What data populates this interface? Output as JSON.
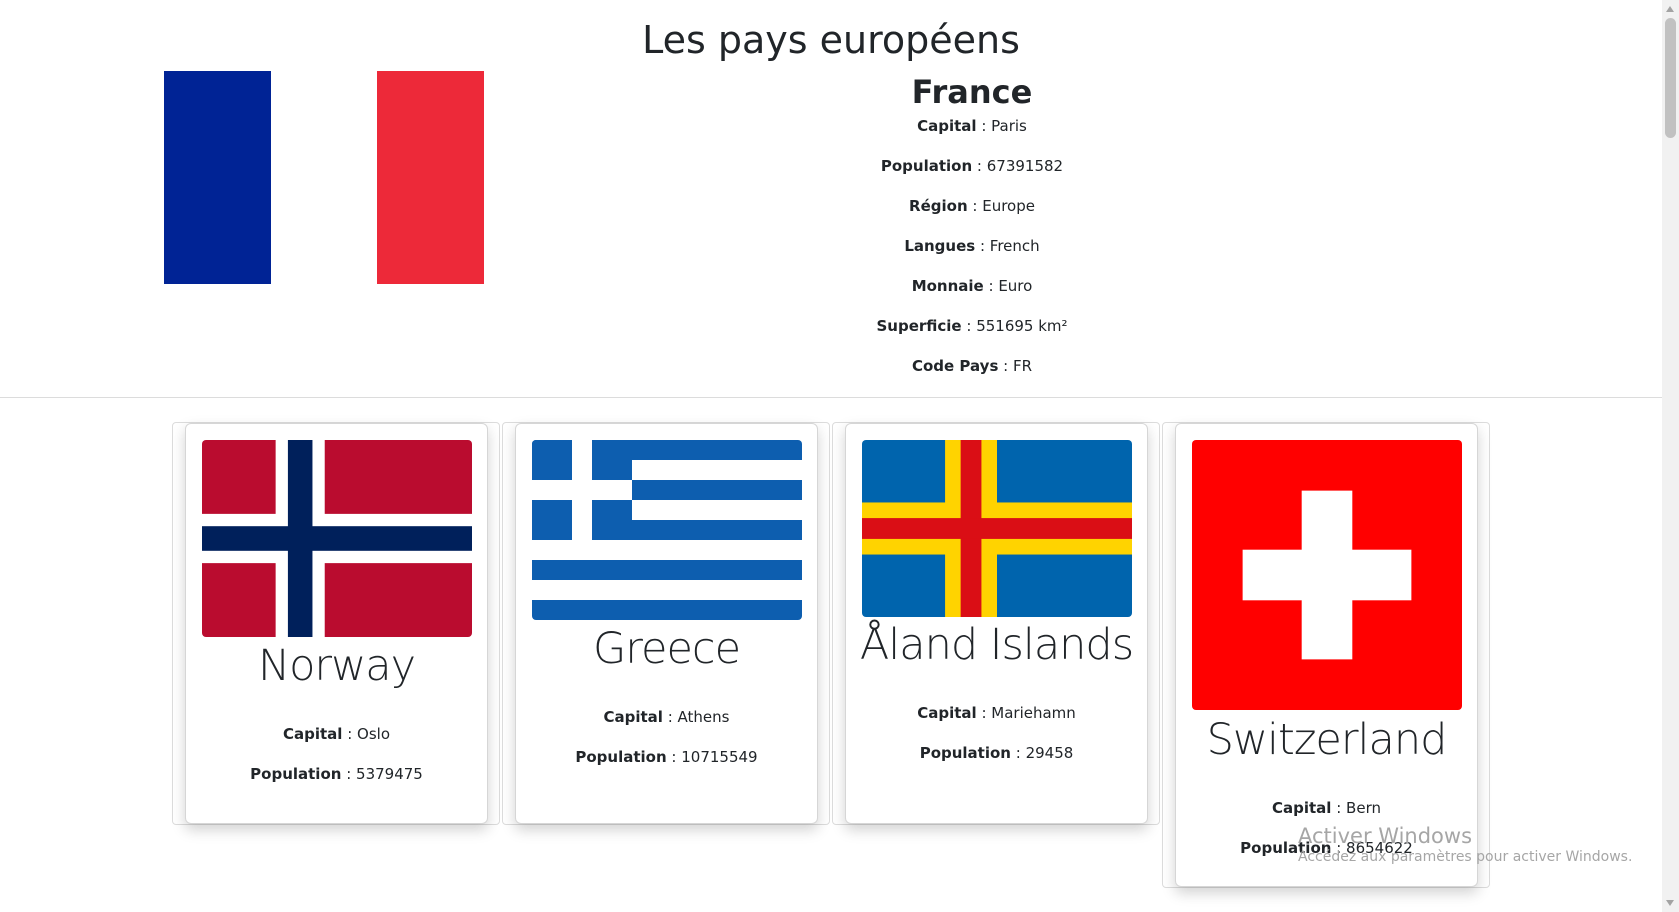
{
  "page": {
    "title": "Les pays européens"
  },
  "featured": {
    "name": "France",
    "flag_colors": [
      "#002395",
      "#ffffff",
      "#ED2939"
    ],
    "fields": [
      {
        "label": "Capital",
        "value": "Paris"
      },
      {
        "label": "Population",
        "value": "67391582"
      },
      {
        "label": "Région",
        "value": "Europe"
      },
      {
        "label": "Langues",
        "value": "French"
      },
      {
        "label": "Monnaie",
        "value": "Euro"
      },
      {
        "label": "Superficie",
        "value": "551695 km²"
      },
      {
        "label": "Code Pays",
        "value": "FR"
      }
    ]
  },
  "cards": [
    {
      "name": "Norway",
      "capital_label": "Capital",
      "capital": "Oslo",
      "population_label": "Population",
      "population": "5379475",
      "flag_icon": "norway-flag"
    },
    {
      "name": "Greece",
      "capital_label": "Capital",
      "capital": "Athens",
      "population_label": "Population",
      "population": "10715549",
      "flag_icon": "greece-flag"
    },
    {
      "name": "Åland Islands",
      "capital_label": "Capital",
      "capital": "Mariehamn",
      "population_label": "Population",
      "population": "29458",
      "flag_icon": "aland-flag"
    },
    {
      "name": "Switzerland",
      "capital_label": "Capital",
      "capital": "Bern",
      "population_label": "Population",
      "population": "8654622",
      "flag_icon": "switzerland-flag"
    }
  ],
  "watermark": {
    "line1": "Activer Windows",
    "line2": "Accédez aux paramètres pour activer Windows."
  }
}
